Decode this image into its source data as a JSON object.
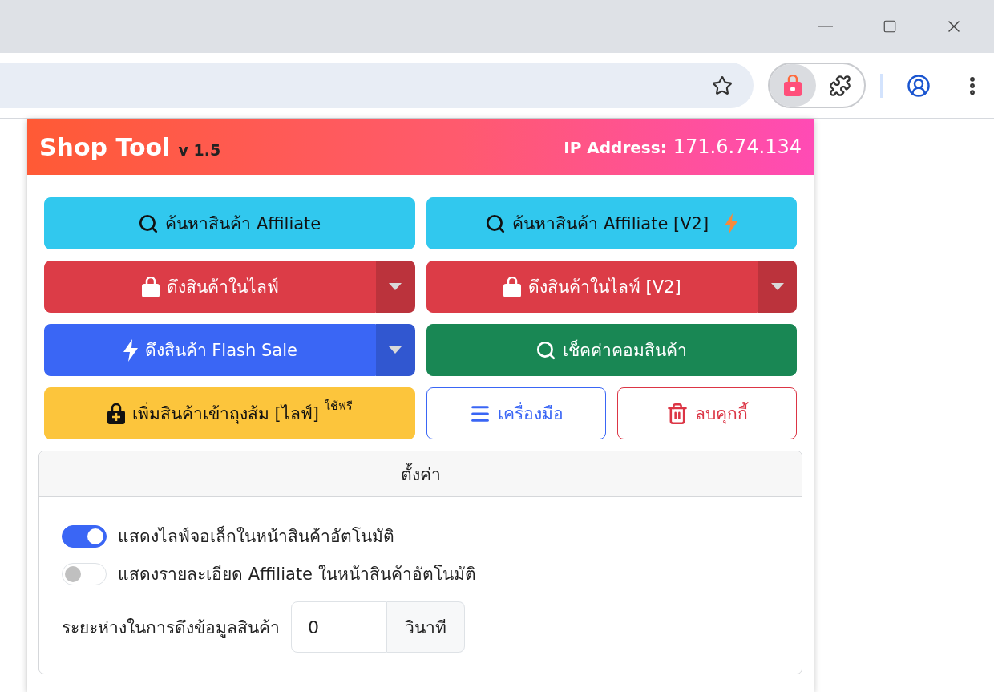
{
  "header": {
    "title": "Shop Tool",
    "version": "v 1.5",
    "ip_label": "IP Address:",
    "ip_value": "171.6.74.134"
  },
  "buttons": [
    {
      "kind": "search",
      "label": "ค้นหาสินค้า Affiliate",
      "color": "#31c8ee"
    },
    {
      "kind": "searchfast",
      "label": "ค้นหาสินค้า Affiliate [V2]",
      "color": "#31c8ee"
    },
    {
      "kind": "live",
      "label": "ดึงสินค้าในไลฟ์",
      "color": "#dc3c47"
    },
    {
      "kind": "live",
      "label": "ดึงสินค้าในไลฟ์ [V2]",
      "color": "#dc3c47"
    },
    {
      "kind": "flash",
      "label": "ดึงสินค้า Flash Sale",
      "color": "#3a66f5"
    },
    {
      "kind": "commission",
      "label": "เช็คค่าคอมสินค้า",
      "color": "#198754"
    },
    {
      "kind": "cart",
      "label": "เพิ่มสินค้าเข้าถุงส้ม [ไลฟ์] $^{ใช้ฟรี}$",
      "color": "#fcc53c"
    },
    {
      "kind": "tools",
      "label": "เครื่องมือ",
      "color": "#3a66f5"
    },
    {
      "kind": "trash",
      "label": "ลบคุกกี้",
      "color": "#dc3545"
    }
  ],
  "settings": {
    "title": "ตั้งค่า",
    "toggles": [
      {
        "label": "แสดงไลฟ์จอเล็กในหน้าสินค้าอัตโนมัติ",
        "on": true
      },
      {
        "label": "แสดงรายละเอียด Affiliate ในหน้าสินค้าอัตโนมัติ",
        "on": false
      }
    ],
    "delay": {
      "label": "ระยะห่างในการดึงข้อมูลสินค้า",
      "value": "0",
      "unit": "วินาที"
    }
  }
}
